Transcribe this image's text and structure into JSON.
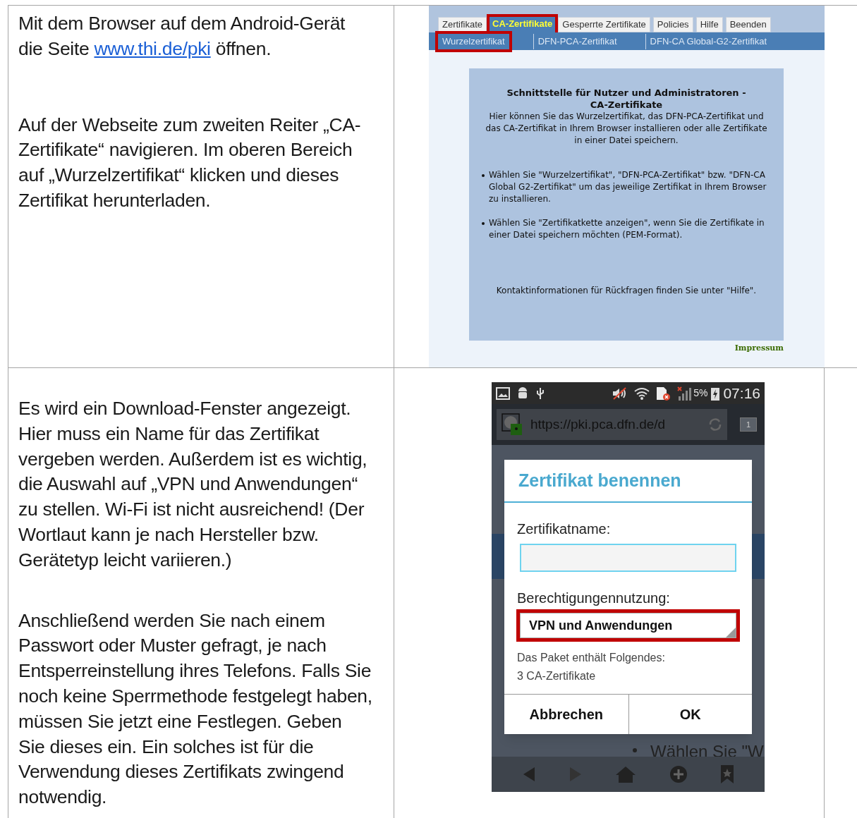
{
  "rows": [
    {
      "instructions": [
        {
          "before": "Mit dem Browser auf dem Android-Gerät die Seite ",
          "link": "www.thi.de/pki",
          "after": " öffnen."
        },
        {
          "before": "Auf der Webseite zum zweiten Reiter „CA-Zertifikate“ navigieren. Im oberen Bereich auf „Wurzelzertifikat“ klicken und dieses Zertifikat herunterladen."
        }
      ],
      "screenshot": {
        "kind": "web",
        "tabs": [
          {
            "label": "Zertifikate",
            "selected": false,
            "highlighted": false
          },
          {
            "label": "CA-Zertifikate",
            "selected": true,
            "highlighted": true
          },
          {
            "label": "Gesperrte Zertifikate",
            "selected": false,
            "highlighted": false
          },
          {
            "label": "Policies",
            "selected": false,
            "highlighted": false
          },
          {
            "label": "Hilfe",
            "selected": false,
            "highlighted": false
          },
          {
            "label": "Beenden",
            "selected": false,
            "highlighted": false
          }
        ],
        "subtabs": [
          {
            "label": "Wurzelzertifikat",
            "highlighted": true
          },
          {
            "label": "DFN-PCA-Zertifikat",
            "highlighted": false
          },
          {
            "label": "DFN-CA Global-G2-Zertifikat",
            "highlighted": false
          }
        ],
        "heading": "Schnittstelle für Nutzer und Administratoren - CA-Zertifikate",
        "intro": "Hier können Sie das Wurzelzertifikat, das DFN-PCA-Zertifikat und das CA-Zertifikat in Ihrem Browser installieren oder alle Zertifikate in einer Datei speichern.",
        "bullets": [
          "Wählen Sie \"Wurzelzertifikat\", \"DFN-PCA-Zertifikat\" bzw. \"DFN-CA Global G2-Zertifikat\" um das jeweilige Zertifikat in Ihrem Browser zu installieren.",
          "Wählen Sie \"Zertifikatkette anzeigen\", wenn Sie die Zertifikate in einer Datei speichern möchten (PEM-Format)."
        ],
        "contact": "Kontaktinformationen für Rückfragen finden Sie unter \"Hilfe\".",
        "footer_link": "Impressum"
      }
    },
    {
      "instructions": [
        {
          "before": "Es wird ein Download-Fenster angezeigt. Hier muss ein Name für das Zertifikat vergeben werden. Außerdem ist es wichtig, die Auswahl auf „VPN und Anwendungen“ zu stellen. Wi-Fi ist nicht ausreichend! (Der Wortlaut kann je nach Hersteller bzw. Gerätetyp leicht variieren.)"
        },
        {
          "before": "Anschließend werden Sie nach einem Passwort oder Muster gefragt, je nach Entsperreinstellung ihres Telefons. Falls Sie noch keine Sperrmethode festgelegt haben, müssen Sie jetzt eine Festlegen. Geben Sie dieses ein. Ein solches ist für die Verwendung dieses Zertifikats zwingend notwendig."
        }
      ],
      "screenshot": {
        "kind": "phone",
        "status": {
          "battery": "5%",
          "time": "07:16"
        },
        "url": "https://pki.pca.dfn.de/d",
        "tab_count": "1",
        "background_fragments": [
          "Wählen Sie \"W"
        ],
        "dialog": {
          "title": "Zertifikat benennen",
          "name_label": "Zertifikatname:",
          "usage_label": "Berechtigungennutzung:",
          "usage_value": "VPN und Anwendungen",
          "usage_highlighted": true,
          "info": [
            "Das Paket enthält Folgendes:",
            "3 CA-Zertifikate"
          ],
          "buttons": [
            "Abbrechen",
            "OK"
          ]
        }
      }
    }
  ]
}
